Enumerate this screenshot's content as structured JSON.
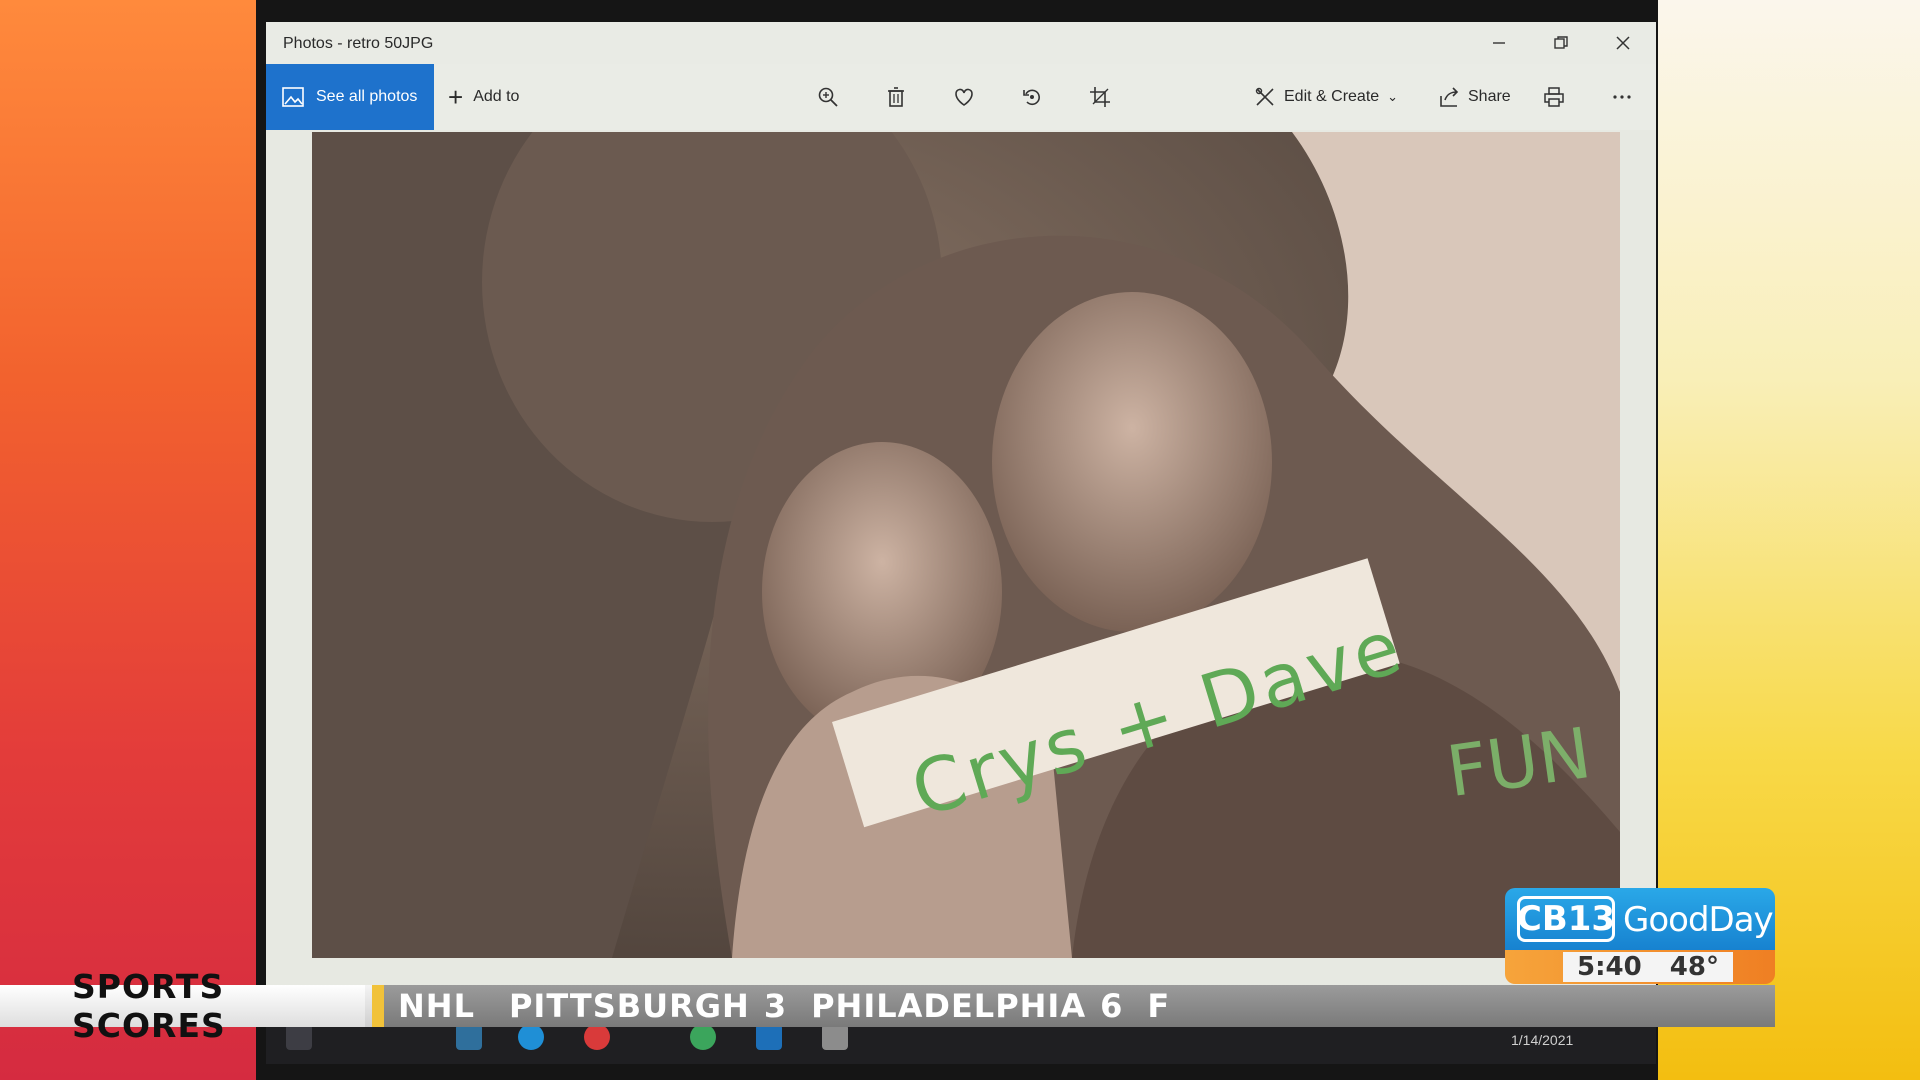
{
  "window": {
    "title": "Photos - retro 50JPG",
    "controls": [
      "minimize",
      "restore",
      "close"
    ]
  },
  "toolbar": {
    "see_all_label": "See all photos",
    "add_to_label": "Add to",
    "edit_create_label": "Edit & Create",
    "share_label": "Share",
    "icons": [
      "zoom-icon",
      "delete-icon",
      "favorite-icon",
      "rotate-icon",
      "crop-icon",
      "print-icon",
      "more-icon"
    ]
  },
  "photo": {
    "caption_main": "Crys + Dave",
    "caption_secondary": "FUN"
  },
  "taskbar": {
    "date": "1/14/2021"
  },
  "ticker": {
    "label": "SPORTS SCORES",
    "league": "NHL",
    "team1": "PITTSBURGH",
    "score1": "3",
    "team2": "PHILADELPHIA",
    "score2": "6",
    "status": "F"
  },
  "bug": {
    "channel": "CB13",
    "show": "GoodDay",
    "time": "5:40",
    "temp": "48°",
    "colors": {
      "blue": "#1e8ad6",
      "orange": "#f3922f"
    }
  }
}
